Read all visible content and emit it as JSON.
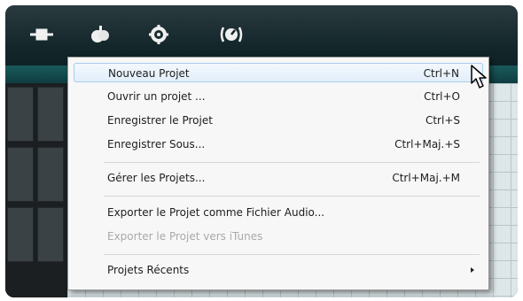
{
  "toolbar": {
    "icons": [
      "cable-icon",
      "apple-icon",
      "gear-icon",
      "gauge-icon"
    ]
  },
  "menu": {
    "items": [
      {
        "label": "Nouveau Projet",
        "shortcut": "Ctrl+N",
        "state": "hover"
      },
      {
        "label": "Ouvrir un projet ...",
        "shortcut": "Ctrl+O",
        "state": "normal"
      },
      {
        "label": "Enregistrer le Projet",
        "shortcut": "Ctrl+S",
        "state": "normal"
      },
      {
        "label": "Enregistrer Sous...",
        "shortcut": "Ctrl+Maj.+S",
        "state": "normal"
      },
      {
        "label": "Gérer les Projets...",
        "shortcut": "Ctrl+Maj.+M",
        "state": "normal"
      },
      {
        "label": "Exporter le Projet comme Fichier Audio...",
        "shortcut": "",
        "state": "normal"
      },
      {
        "label": "Exporter le Projet vers iTunes",
        "shortcut": "",
        "state": "disabled"
      },
      {
        "label": "Projets Récents",
        "shortcut": "",
        "state": "submenu"
      }
    ]
  },
  "colors": {
    "frame": "#0f2226",
    "menu_background": "#f7f7f7",
    "hover_border": "#a8cbee",
    "disabled_text": "#a9a9a9"
  }
}
